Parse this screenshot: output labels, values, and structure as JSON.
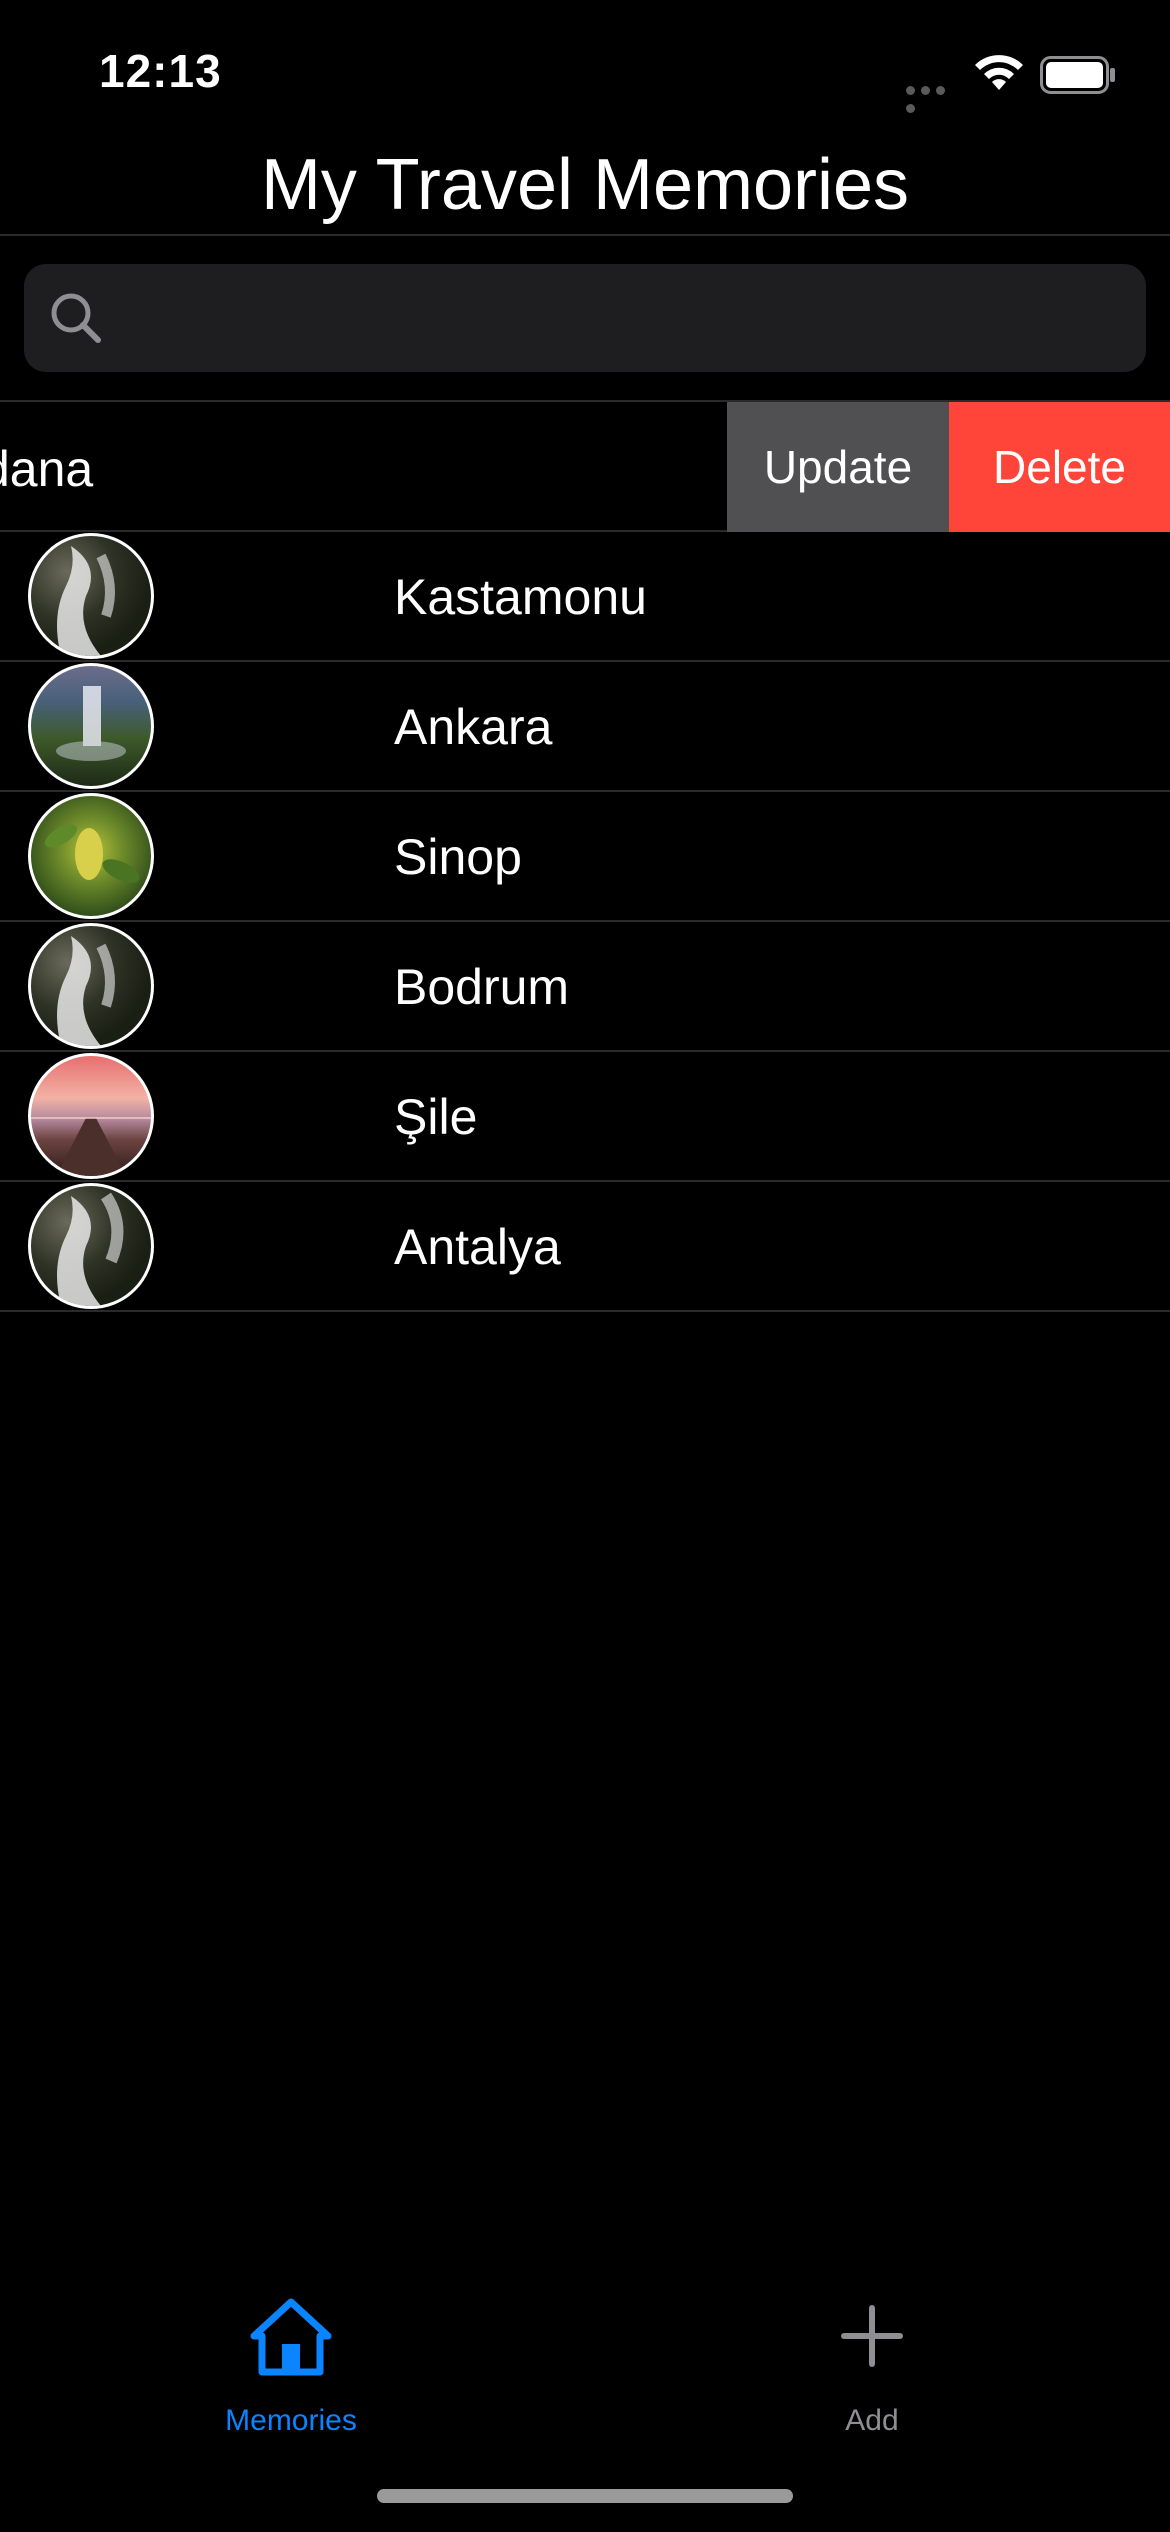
{
  "status_bar": {
    "time": "12:13"
  },
  "nav": {
    "title": "My Travel Memories"
  },
  "search": {
    "placeholder": "",
    "value": ""
  },
  "swiped_row": {
    "label": "dana",
    "actions": {
      "update": "Update",
      "delete": "Delete"
    }
  },
  "list": {
    "items": [
      {
        "label": "Kastamonu",
        "image": "waterfall"
      },
      {
        "label": "Ankara",
        "image": "cascade"
      },
      {
        "label": "Sinop",
        "image": "leaf"
      },
      {
        "label": "Bodrum",
        "image": "waterfall"
      },
      {
        "label": "Şile",
        "image": "pier"
      },
      {
        "label": "Antalya",
        "image": "waterfall"
      }
    ]
  },
  "tab_bar": {
    "tabs": [
      {
        "label": "Memories",
        "icon": "house-icon",
        "selected": true
      },
      {
        "label": "Add",
        "icon": "plus-icon",
        "selected": false
      }
    ]
  },
  "colors": {
    "accent": "#0a84ff",
    "delete": "#ff453a",
    "update": "#505052",
    "background": "#000000"
  }
}
